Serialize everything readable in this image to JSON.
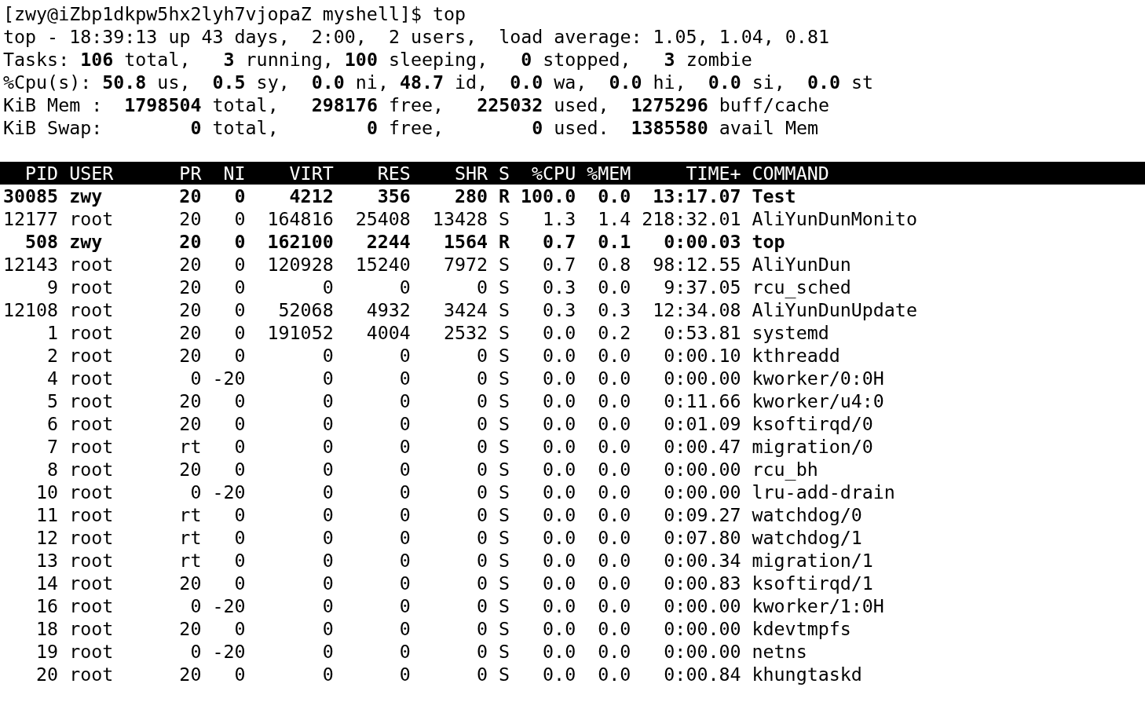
{
  "prompt": "[zwy@iZbp1dkpw5hx2lyh7vjopaZ myshell]$ top",
  "summary": [
    "top - 18:39:13 up 43 days,  2:00,  2 users,  load average: 1.05, 1.04, 0.81",
    "Tasks: **106** total,   **3** running, **100** sleeping,   **0** stopped,   **3** zombie",
    "%Cpu(s): **50.8** us,  **0.5** sy,  **0.0** ni, **48.7** id,  **0.0** wa,  **0.0** hi,  **0.0** si,  **0.0** st",
    "KiB Mem :  **1798504** total,   **298176** free,   **225032** used,  **1275296** buff/cache",
    "KiB Swap:        **0** total,        **0** free,        **0** used.  **1385580** avail Mem"
  ],
  "table": {
    "columns": [
      "PID",
      "USER",
      "PR",
      "NI",
      "VIRT",
      "RES",
      "SHR",
      "S",
      "%CPU",
      "%MEM",
      "TIME+",
      "COMMAND"
    ],
    "rows": [
      {
        "highlighted": true,
        "cells": [
          "30085",
          "zwy",
          "20",
          "0",
          "4212",
          "356",
          "280",
          "R",
          "100.0",
          "0.0",
          "13:17.07",
          "Test"
        ]
      },
      {
        "highlighted": false,
        "cells": [
          "12177",
          "root",
          "20",
          "0",
          "164816",
          "25408",
          "13428",
          "S",
          "1.3",
          "1.4",
          "218:32.01",
          "AliYunDunMonito"
        ]
      },
      {
        "highlighted": true,
        "cells": [
          "508",
          "zwy",
          "20",
          "0",
          "162100",
          "2244",
          "1564",
          "R",
          "0.7",
          "0.1",
          "0:00.03",
          "top"
        ]
      },
      {
        "highlighted": false,
        "cells": [
          "12143",
          "root",
          "20",
          "0",
          "120928",
          "15240",
          "7972",
          "S",
          "0.7",
          "0.8",
          "98:12.55",
          "AliYunDun"
        ]
      },
      {
        "highlighted": false,
        "cells": [
          "9",
          "root",
          "20",
          "0",
          "0",
          "0",
          "0",
          "S",
          "0.3",
          "0.0",
          "9:37.05",
          "rcu_sched"
        ]
      },
      {
        "highlighted": false,
        "cells": [
          "12108",
          "root",
          "20",
          "0",
          "52068",
          "4932",
          "3424",
          "S",
          "0.3",
          "0.3",
          "12:34.08",
          "AliYunDunUpdate"
        ]
      },
      {
        "highlighted": false,
        "cells": [
          "1",
          "root",
          "20",
          "0",
          "191052",
          "4004",
          "2532",
          "S",
          "0.0",
          "0.2",
          "0:53.81",
          "systemd"
        ]
      },
      {
        "highlighted": false,
        "cells": [
          "2",
          "root",
          "20",
          "0",
          "0",
          "0",
          "0",
          "S",
          "0.0",
          "0.0",
          "0:00.10",
          "kthreadd"
        ]
      },
      {
        "highlighted": false,
        "cells": [
          "4",
          "root",
          "0",
          "-20",
          "0",
          "0",
          "0",
          "S",
          "0.0",
          "0.0",
          "0:00.00",
          "kworker/0:0H"
        ]
      },
      {
        "highlighted": false,
        "cells": [
          "5",
          "root",
          "20",
          "0",
          "0",
          "0",
          "0",
          "S",
          "0.0",
          "0.0",
          "0:11.66",
          "kworker/u4:0"
        ]
      },
      {
        "highlighted": false,
        "cells": [
          "6",
          "root",
          "20",
          "0",
          "0",
          "0",
          "0",
          "S",
          "0.0",
          "0.0",
          "0:01.09",
          "ksoftirqd/0"
        ]
      },
      {
        "highlighted": false,
        "cells": [
          "7",
          "root",
          "rt",
          "0",
          "0",
          "0",
          "0",
          "S",
          "0.0",
          "0.0",
          "0:00.47",
          "migration/0"
        ]
      },
      {
        "highlighted": false,
        "cells": [
          "8",
          "root",
          "20",
          "0",
          "0",
          "0",
          "0",
          "S",
          "0.0",
          "0.0",
          "0:00.00",
          "rcu_bh"
        ]
      },
      {
        "highlighted": false,
        "cells": [
          "10",
          "root",
          "0",
          "-20",
          "0",
          "0",
          "0",
          "S",
          "0.0",
          "0.0",
          "0:00.00",
          "lru-add-drain"
        ]
      },
      {
        "highlighted": false,
        "cells": [
          "11",
          "root",
          "rt",
          "0",
          "0",
          "0",
          "0",
          "S",
          "0.0",
          "0.0",
          "0:09.27",
          "watchdog/0"
        ]
      },
      {
        "highlighted": false,
        "cells": [
          "12",
          "root",
          "rt",
          "0",
          "0",
          "0",
          "0",
          "S",
          "0.0",
          "0.0",
          "0:07.80",
          "watchdog/1"
        ]
      },
      {
        "highlighted": false,
        "cells": [
          "13",
          "root",
          "rt",
          "0",
          "0",
          "0",
          "0",
          "S",
          "0.0",
          "0.0",
          "0:00.34",
          "migration/1"
        ]
      },
      {
        "highlighted": false,
        "cells": [
          "14",
          "root",
          "20",
          "0",
          "0",
          "0",
          "0",
          "S",
          "0.0",
          "0.0",
          "0:00.83",
          "ksoftirqd/1"
        ]
      },
      {
        "highlighted": false,
        "cells": [
          "16",
          "root",
          "0",
          "-20",
          "0",
          "0",
          "0",
          "S",
          "0.0",
          "0.0",
          "0:00.00",
          "kworker/1:0H"
        ]
      },
      {
        "highlighted": false,
        "cells": [
          "18",
          "root",
          "20",
          "0",
          "0",
          "0",
          "0",
          "S",
          "0.0",
          "0.0",
          "0:00.00",
          "kdevtmpfs"
        ]
      },
      {
        "highlighted": false,
        "cells": [
          "19",
          "root",
          "0",
          "-20",
          "0",
          "0",
          "0",
          "S",
          "0.0",
          "0.0",
          "0:00.00",
          "netns"
        ]
      },
      {
        "highlighted": false,
        "cells": [
          "20",
          "root",
          "20",
          "0",
          "0",
          "0",
          "0",
          "S",
          "0.0",
          "0.0",
          "0:00.84",
          "khungtaskd"
        ]
      }
    ]
  }
}
